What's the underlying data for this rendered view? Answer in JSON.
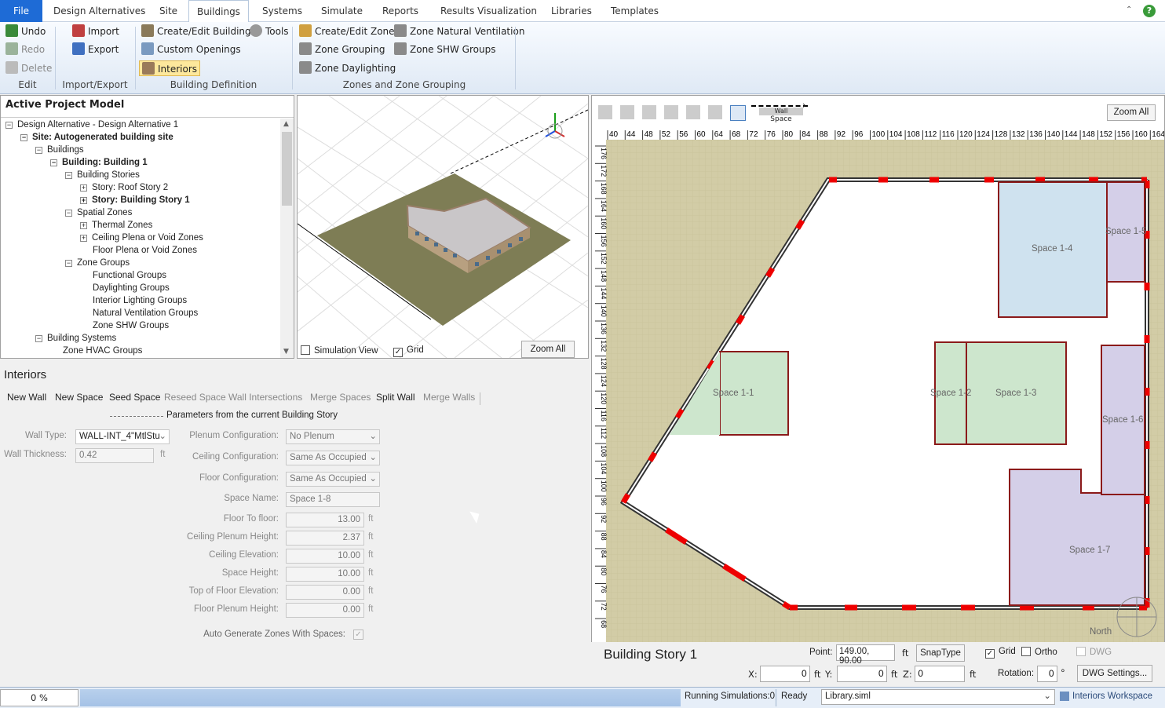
{
  "menu": {
    "file": "File",
    "tabs": [
      "Design Alternatives",
      "Site",
      "Buildings",
      "Systems",
      "Simulate",
      "Reports",
      "Results Visualization",
      "Libraries",
      "Templates"
    ],
    "active": "Buildings"
  },
  "ribbon": {
    "edit": {
      "undo": "Undo",
      "redo": "Redo",
      "delete": "Delete",
      "label": "Edit"
    },
    "import_export": {
      "import": "Import",
      "export": "Export",
      "label": "Import/Export"
    },
    "building_def": {
      "create_edit": "Create/Edit Buildings",
      "tools": "Tools",
      "custom_openings": "Custom Openings",
      "interiors": "Interiors",
      "label": "Building Definition"
    },
    "zones": {
      "create_edit_zones": "Create/Edit Zones",
      "zone_natural_vent": "Zone Natural Ventilation",
      "zone_grouping": "Zone Grouping",
      "zone_shw": "Zone SHW Groups",
      "zone_daylighting": "Zone Daylighting",
      "label": "Zones and Zone Grouping"
    }
  },
  "tree": {
    "title": "Active Project Model",
    "nodes": [
      "Design Alternative - Design Alternative 1",
      "Site: Autogenerated building site",
      "Buildings",
      "Building: Building 1",
      "Building Stories",
      "Story: Roof Story 2",
      "Story: Building Story 1",
      "Spatial Zones",
      "Thermal Zones",
      "Ceiling Plena or Void Zones",
      "Floor Plena or Void Zones",
      "Zone Groups",
      "Functional Groups",
      "Daylighting Groups",
      "Interior Lighting Groups",
      "Natural Ventilation Groups",
      "Zone SHW Groups",
      "Building Systems",
      "Zone HVAC Groups"
    ]
  },
  "view3d": {
    "simulation_view": "Simulation View",
    "grid": "Grid",
    "zoom_all": "Zoom All"
  },
  "interiors": {
    "title": "Interiors",
    "toolbar": [
      "New Wall",
      "New Space",
      "Seed Space",
      "Reseed Space",
      "Wall Intersections",
      "Merge Spaces",
      "Split Wall",
      "Merge Walls"
    ],
    "section_title": "Parameters from the current Building Story",
    "wall_type_label": "Wall Type:",
    "wall_type": "WALL-INT_4\"MtlStu",
    "wall_thickness_label": "Wall Thickness:",
    "wall_thickness": "0.42",
    "unit_ft": "ft",
    "plenum_config_label": "Plenum Configuration:",
    "plenum_config": "No Plenum",
    "ceiling_config_label": "Ceiling Configuration:",
    "ceiling_config": "Same As Occupied",
    "floor_config_label": "Floor Configuration:",
    "floor_config": "Same As Occupied",
    "space_name_label": "Space Name:",
    "space_name": "Space 1-8",
    "floor_to_floor_label": "Floor To floor:",
    "floor_to_floor": "13.00",
    "ceiling_plenum_label": "Ceiling Plenum Height:",
    "ceiling_plenum": "2.37",
    "ceiling_elev_label": "Ceiling Elevation:",
    "ceiling_elev": "10.00",
    "space_height_label": "Space Height:",
    "space_height": "10.00",
    "top_floor_label": "Top of Floor Elevation:",
    "top_floor": "0.00",
    "floor_plenum_label": "Floor Plenum Height:",
    "floor_plenum": "0.00",
    "auto_gen_label": "Auto Generate Zones With Spaces:"
  },
  "plan": {
    "zoom_all": "Zoom All",
    "wall": "Wall",
    "space": "Space",
    "north": "North",
    "ruler_top": [
      "40",
      "44",
      "48",
      "52",
      "56",
      "60",
      "64",
      "68",
      "72",
      "76",
      "80",
      "84",
      "88",
      "92",
      "96",
      "100",
      "104",
      "108",
      "112",
      "116",
      "120",
      "124",
      "128",
      "132",
      "136",
      "140",
      "144",
      "148",
      "152",
      "156",
      "160",
      "164"
    ],
    "ruler_left": [
      "176",
      "172",
      "168",
      "164",
      "160",
      "156",
      "152",
      "148",
      "144",
      "140",
      "136",
      "132",
      "128",
      "124",
      "120",
      "116",
      "112",
      "108",
      "104",
      "100",
      "96",
      "92",
      "88",
      "84",
      "80",
      "76",
      "72",
      "68"
    ],
    "spaces": [
      "Space 1-1",
      "Space 1-2",
      "Space 1-3",
      "Space 1-4",
      "Space 1-5",
      "Space 1-6",
      "Space 1-7"
    ],
    "story": "Building Story 1",
    "point_label": "Point:",
    "point": "149.00, 90.00",
    "unit_ft": "ft",
    "snap": "SnapType",
    "grid": "Grid",
    "ortho": "Ortho",
    "dwg": "DWG",
    "x_label": "X:",
    "x": "0",
    "y_label": "Y:",
    "y": "0",
    "z_label": "Z:",
    "z": "0",
    "rotation_label": "Rotation:",
    "rotation": "0",
    "deg": "°",
    "dwg_settings": "DWG Settings..."
  },
  "status": {
    "progress": "0 %",
    "running": "Running Simulations:0",
    "ready": "Ready",
    "library": "Library.siml",
    "workspace": "Interiors Workspace"
  }
}
